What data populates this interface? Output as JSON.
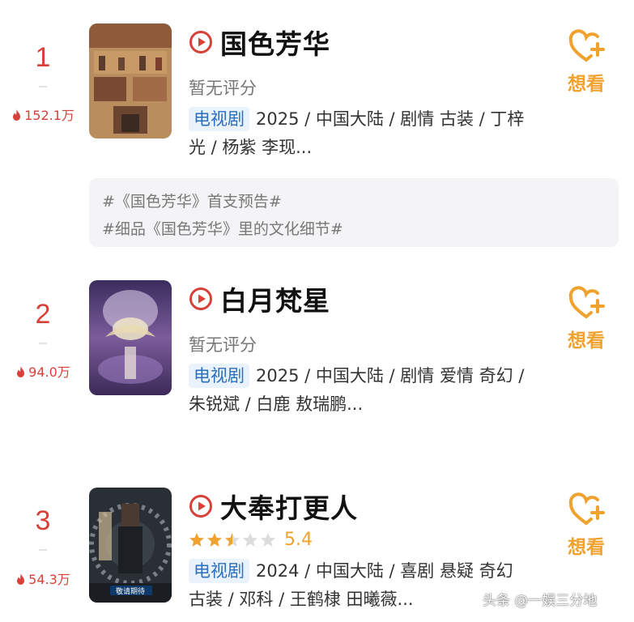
{
  "colors": {
    "rank_red": "#d8413a",
    "want_orange": "#f0a22e",
    "badge_blue": "#2c6fbd",
    "badge_bg": "#eaf2fb"
  },
  "items": [
    {
      "rank": "1",
      "heat": "152.1万",
      "title": "国色芳华",
      "rating_text": "暂无评分",
      "badge": "电视剧",
      "info_line1": "2025 / 中国大陆 / 剧情 古装 / 丁梓",
      "info_line2": "光 / 杨紫 李现...",
      "want_label": "想看",
      "topics": [
        "#《国色芳华》首支预告#",
        "#细品《国色芳华》里的文化细节#"
      ]
    },
    {
      "rank": "2",
      "heat": "94.0万",
      "title": "白月梵星",
      "rating_text": "暂无评分",
      "badge": "电视剧",
      "info_line1": "2025 / 中国大陆 / 剧情 爱情 奇幻 /",
      "info_line2": "朱锐斌 / 白鹿 敖瑞鹏...",
      "want_label": "想看"
    },
    {
      "rank": "3",
      "heat": "54.3万",
      "title": "大奉打更人",
      "score": "5.4",
      "stars": 2.5,
      "badge": "电视剧",
      "info_line1": "2024 / 中国大陆 / 喜剧 悬疑 奇幻",
      "info_line2": "古装 / 邓科 / 王鹤棣 田曦薇...",
      "want_label": "想看",
      "poster_text": "敬请期待"
    }
  ],
  "watermark": "头条 @一娱三分地"
}
